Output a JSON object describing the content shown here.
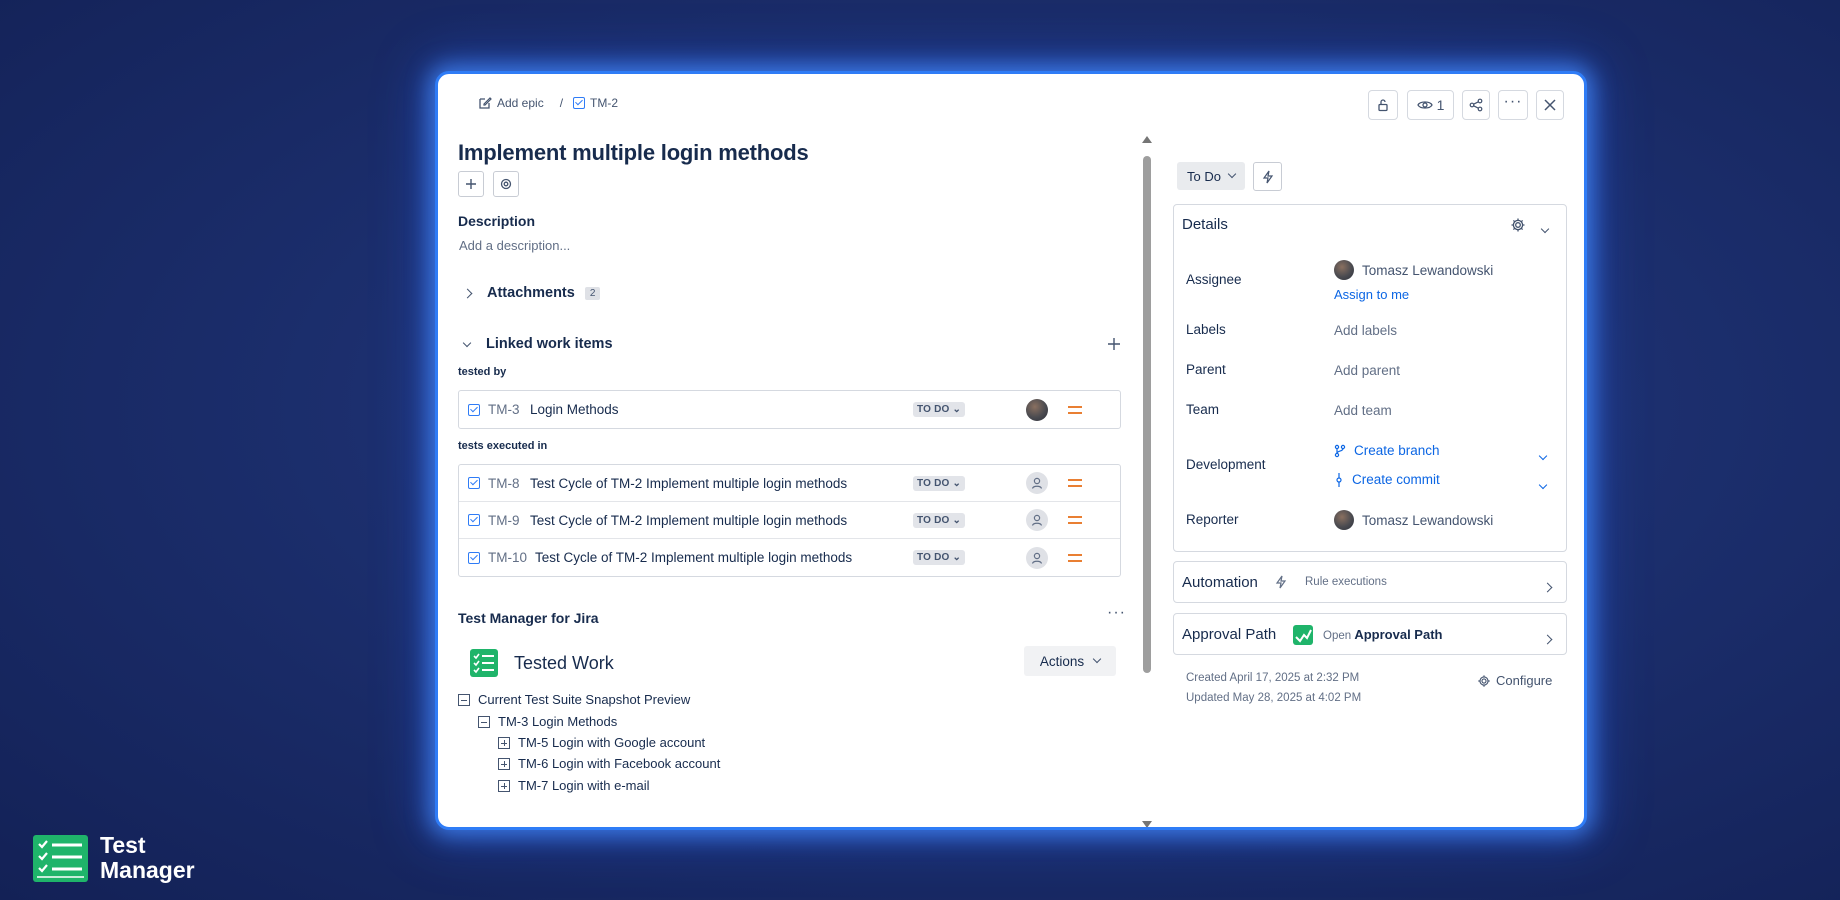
{
  "breadcrumb": {
    "epic_label": "Add epic",
    "separator": "/",
    "issue_key": "TM-2"
  },
  "header_actions": {
    "watchers_count": "1"
  },
  "issue": {
    "title": "Implement multiple login methods"
  },
  "description": {
    "heading": "Description",
    "placeholder": "Add a description..."
  },
  "attachments": {
    "label": "Attachments",
    "count": "2"
  },
  "linked": {
    "heading": "Linked work items",
    "groups": [
      {
        "label": "tested by",
        "rows": [
          {
            "key": "TM-3",
            "summary": "Login Methods",
            "status": "TO DO"
          }
        ]
      },
      {
        "label": "tests executed in",
        "rows": [
          {
            "key": "TM-8",
            "summary": "Test Cycle of TM-2 Implement multiple login methods",
            "status": "TO DO"
          },
          {
            "key": "TM-9",
            "summary": "Test Cycle of TM-2 Implement multiple login methods",
            "status": "TO DO"
          },
          {
            "key": "TM-10",
            "summary": "Test Cycle of TM-2 Implement multiple login methods",
            "status": "TO DO"
          }
        ]
      }
    ]
  },
  "test_manager": {
    "heading": "Test Manager for Jira",
    "panel_title": "Tested Work",
    "actions_label": "Actions",
    "tree": [
      {
        "label": "Current Test Suite Snapshot Preview"
      },
      {
        "label": "TM-3 Login Methods"
      },
      {
        "label": "TM-5 Login with Google account"
      },
      {
        "label": "TM-6 Login with Facebook account"
      },
      {
        "label": "TM-7 Login with e-mail"
      }
    ]
  },
  "status_button": {
    "label": "To Do"
  },
  "details": {
    "heading": "Details",
    "assignee_label": "Assignee",
    "assignee_name": "Tomasz Lewandowski",
    "assign_to_me": "Assign to me",
    "labels_label": "Labels",
    "labels_value": "Add labels",
    "parent_label": "Parent",
    "parent_value": "Add parent",
    "team_label": "Team",
    "team_value": "Add team",
    "development_label": "Development",
    "create_branch": "Create branch",
    "create_commit": "Create commit",
    "reporter_label": "Reporter",
    "reporter_name": "Tomasz Lewandowski"
  },
  "automation": {
    "label": "Automation",
    "sub": "Rule executions"
  },
  "approval": {
    "label": "Approval Path",
    "open": "Open",
    "link": "Approval Path"
  },
  "meta": {
    "created": "Created April 17, 2025 at 2:32 PM",
    "updated": "Updated May 28, 2025 at 4:02 PM",
    "configure": "Configure"
  },
  "brand": {
    "line1": "Test",
    "line2": "Manager"
  },
  "colors": {
    "accent": "#2f7cf6",
    "priority": "#e97f33",
    "link": "#0c66e4",
    "brand_green": "#1fb46a"
  }
}
